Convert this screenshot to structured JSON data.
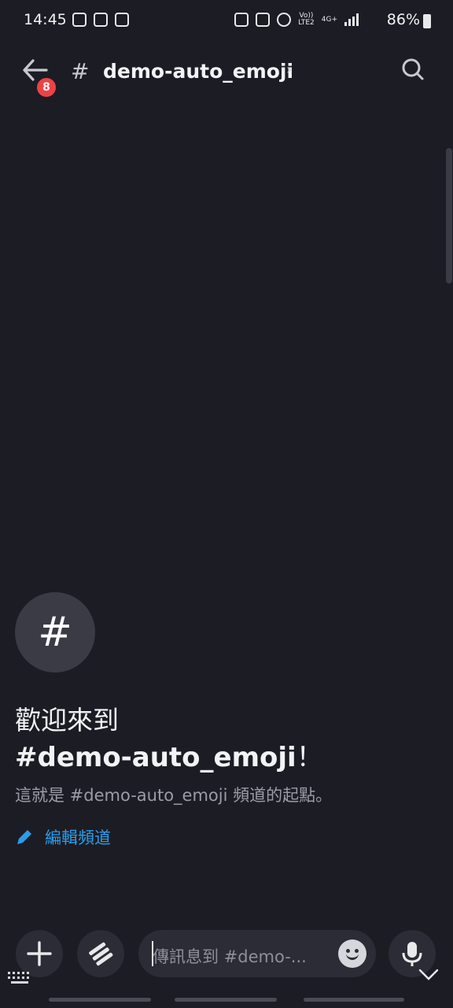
{
  "status_bar": {
    "time": "14:45",
    "network_top": "Vo))",
    "network_bottom": "LTE2",
    "net_type": "4G+",
    "battery": "86%"
  },
  "header": {
    "channel_name": "demo-auto_emoji",
    "hash": "#",
    "unread_badge": "8",
    "chevron": "›"
  },
  "welcome": {
    "avatar_symbol": "#",
    "line1": "歡迎來到",
    "channel_name": "#demo-auto_emoji",
    "exclaim": "！",
    "description": "這就是 #demo-auto_emoji 頻道的起點。",
    "edit_label": "編輯頻道"
  },
  "composer": {
    "placeholder": "傳訊息到 #demo-..."
  },
  "colors": {
    "background": "#1c1c24",
    "accent": "#2b9de8",
    "badge": "#ed4245"
  }
}
